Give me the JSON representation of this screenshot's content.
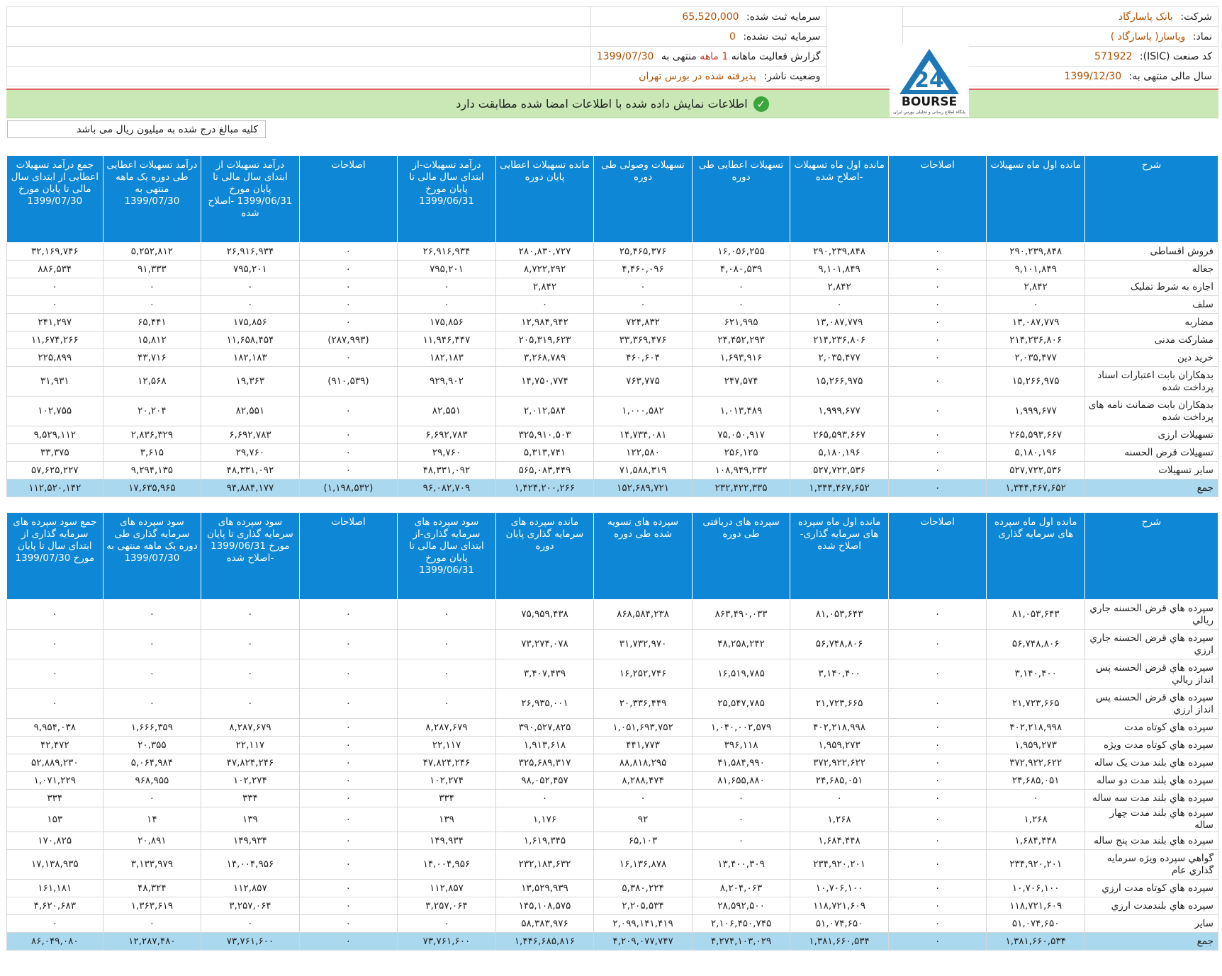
{
  "header": {
    "company_label": "شرکت:",
    "company_value": "بانک پاسارگاد",
    "symbol_label": "نماد:",
    "symbol_value": "وپاسار( پاسارگاد )",
    "isic_label": "کد صنعت (ISIC):",
    "isic_value": "571922",
    "fy_label": "سال مالی منتهی به:",
    "fy_value": "1399/12/30",
    "cap_reg_label": "سرمایه ثبت شده:",
    "cap_reg_value": "65,520,000",
    "cap_unreg_label": "سرمایه ثبت نشده:",
    "cap_unreg_value": "0",
    "report_prefix": "گزارش فعالیت ماهانه",
    "report_months": "1 ماهه",
    "report_mid": "منتهی به",
    "report_date": "1399/07/30",
    "status_label": "وضعیت ناشر:",
    "status_value": "پذیرفته شده در بورس تهران"
  },
  "logo": {
    "brand": "BOURSE",
    "tagline": "پایگاه اطلاع رسانی و تحلیلی بورس ایران"
  },
  "banner": {
    "text": "اطلاعات نمایش داده شده با اطلاعات امضا شده مطابقت دارد",
    "icon": "check-circle-icon",
    "color": "#c9e8b5"
  },
  "note": "کلیه مبالغ درج شده به میلیون ریال می باشد",
  "colors": {
    "header_bg": "#0d87d6",
    "total_bg": "#a9d8ef",
    "accent": "#b05000"
  },
  "table1": {
    "headers": [
      "شرح",
      "مانده اول ماه تسهیلات",
      "اصلاحات",
      "مانده اول ماه تسهیلات -اصلاح شده",
      "تسهیلات اعطایی طی دوره",
      "تسهیلات وصولی طی دوره",
      "مانده تسهیلات اعطایی پایان دوره",
      "درآمد تسهیلات-از ابتدای سال مالی تا پایان مورخ 1399/06/31",
      "اصلاحات",
      "درآمد تسهیلات از ابتدای سال مالی تا پایان مورخ 1399/06/31 -اصلاح شده",
      "درآمد تسهیلات اعطایی طی دوره یک ماهه منتهی به 1399/07/30",
      "جمع درآمد تسهیلات اعطایی از ابتدای سال مالی تا پایان مورخ 1399/07/30"
    ],
    "rows": [
      [
        "فروش اقساطی",
        "۲۹۰,۲۳۹,۸۴۸",
        "۰",
        "۲۹۰,۲۳۹,۸۴۸",
        "۱۶,۰۵۶,۲۵۵",
        "۲۵,۴۶۵,۳۷۶",
        "۲۸۰,۸۳۰,۷۲۷",
        "۲۶,۹۱۶,۹۳۴",
        "۰",
        "۲۶,۹۱۶,۹۳۴",
        "۵,۲۵۲,۸۱۲",
        "۳۲,۱۶۹,۷۴۶"
      ],
      [
        "جعاله",
        "۹,۱۰۱,۸۴۹",
        "۰",
        "۹,۱۰۱,۸۴۹",
        "۴,۰۸۰,۵۳۹",
        "۴,۴۶۰,۰۹۶",
        "۸,۷۲۲,۲۹۲",
        "۷۹۵,۲۰۱",
        "۰",
        "۷۹۵,۲۰۱",
        "۹۱,۳۳۳",
        "۸۸۶,۵۳۴"
      ],
      [
        "اجاره به شرط تملیک",
        "۲,۸۴۲",
        "۰",
        "۲,۸۴۲",
        "۰",
        "۰",
        "۲,۸۴۲",
        "۰",
        "۰",
        "۰",
        "۰",
        "۰"
      ],
      [
        "سلف",
        "۰",
        "۰",
        "۰",
        "۰",
        "۰",
        "۰",
        "۰",
        "۰",
        "۰",
        "۰",
        "۰"
      ],
      [
        "مضاربه",
        "۱۳,۰۸۷,۷۷۹",
        "۰",
        "۱۳,۰۸۷,۷۷۹",
        "۶۲۱,۹۹۵",
        "۷۲۴,۸۳۲",
        "۱۲,۹۸۴,۹۴۲",
        "۱۷۵,۸۵۶",
        "۰",
        "۱۷۵,۸۵۶",
        "۶۵,۴۴۱",
        "۲۴۱,۲۹۷"
      ],
      [
        "مشارکت مدنی",
        "۲۱۴,۲۳۶,۸۰۶",
        "۰",
        "۲۱۴,۲۳۶,۸۰۶",
        "۲۴,۴۵۲,۲۹۳",
        "۳۳,۳۶۹,۴۷۶",
        "۲۰۵,۳۱۹,۶۲۳",
        "۱۱,۹۴۶,۴۴۷",
        "(۲۸۷,۹۹۳)",
        "۱۱,۶۵۸,۴۵۴",
        "۱۵,۸۱۲",
        "۱۱,۶۷۴,۲۶۶"
      ],
      [
        "خرید دین",
        "۲,۰۳۵,۴۷۷",
        "۰",
        "۲,۰۳۵,۴۷۷",
        "۱,۶۹۳,۹۱۶",
        "۴۶۰,۶۰۴",
        "۳,۲۶۸,۷۸۹",
        "۱۸۲,۱۸۳",
        "۰",
        "۱۸۲,۱۸۳",
        "۴۳,۷۱۶",
        "۲۲۵,۸۹۹"
      ],
      [
        "بدهکاران بابت اعتبارات اسناد پرداخت شده",
        "۱۵,۲۶۶,۹۷۵",
        "۰",
        "۱۵,۲۶۶,۹۷۵",
        "۲۴۷,۵۷۴",
        "۷۶۳,۷۷۵",
        "۱۴,۷۵۰,۷۷۴",
        "۹۲۹,۹۰۲",
        "(۹۱۰,۵۳۹)",
        "۱۹,۳۶۳",
        "۱۲,۵۶۸",
        "۳۱,۹۳۱"
      ],
      [
        "بدهکاران بابت ضمانت نامه های پرداخت شده",
        "۱,۹۹۹,۶۷۷",
        "۰",
        "۱,۹۹۹,۶۷۷",
        "۱,۰۱۳,۴۸۹",
        "۱,۰۰۰,۵۸۲",
        "۲,۰۱۲,۵۸۴",
        "۸۲,۵۵۱",
        "۰",
        "۸۲,۵۵۱",
        "۲۰,۲۰۴",
        "۱۰۲,۷۵۵"
      ],
      [
        "تسهیلات ارزی",
        "۲۶۵,۵۹۳,۶۶۷",
        "۰",
        "۲۶۵,۵۹۳,۶۶۷",
        "۷۵,۰۵۰,۹۱۷",
        "۱۴,۷۳۴,۰۸۱",
        "۳۲۵,۹۱۰,۵۰۳",
        "۶,۶۹۲,۷۸۳",
        "۰",
        "۶,۶۹۲,۷۸۳",
        "۲,۸۳۶,۳۲۹",
        "۹,۵۲۹,۱۱۲"
      ],
      [
        "تسهیلات قرض الحسنه",
        "۵,۱۸۰,۱۹۶",
        "۰",
        "۵,۱۸۰,۱۹۶",
        "۲۵۶,۱۲۵",
        "۱۲۲,۵۸۰",
        "۵,۳۱۳,۷۴۱",
        "۲۹,۷۶۰",
        "۰",
        "۲۹,۷۶۰",
        "۳,۶۱۵",
        "۳۳,۳۷۵"
      ],
      [
        "سایر تسهیلات",
        "۵۲۷,۷۲۲,۵۳۶",
        "۰",
        "۵۲۷,۷۲۲,۵۳۶",
        "۱۰۸,۹۴۹,۲۳۲",
        "۷۱,۵۸۸,۳۱۹",
        "۵۶۵,۰۸۳,۴۴۹",
        "۴۸,۳۳۱,۰۹۲",
        "۰",
        "۴۸,۳۳۱,۰۹۲",
        "۹,۲۹۴,۱۳۵",
        "۵۷,۶۲۵,۲۲۷"
      ]
    ],
    "total": [
      "جمع",
      "۱,۳۴۴,۴۶۷,۶۵۲",
      "۰",
      "۱,۳۴۴,۴۶۷,۶۵۲",
      "۲۳۲,۴۲۲,۳۳۵",
      "۱۵۲,۶۸۹,۷۲۱",
      "۱,۴۲۴,۲۰۰,۲۶۶",
      "۹۶,۰۸۲,۷۰۹",
      "(۱,۱۹۸,۵۳۲)",
      "۹۴,۸۸۴,۱۷۷",
      "۱۷,۶۳۵,۹۶۵",
      "۱۱۲,۵۲۰,۱۴۲"
    ]
  },
  "table2": {
    "headers": [
      "شرح",
      "مانده اول ماه سپرده های سرمایه گذاری",
      "اصلاحات",
      "مانده اول ماه سپرده های سرمایه گذاری- اصلاح شده",
      "سپرده های دریافتی طی دوره",
      "سپرده های تسویه شده طی دوره",
      "مانده سپرده های سرمایه گذاری پایان دوره",
      "سود سپرده های سرمایه گذاری-از ابتدای سال مالی تا پایان مورخ 1399/06/31",
      "اصلاحات",
      "سود سپرده های سرمایه گذاری تا پایان مورخ 1399/06/31 -اصلاح شده",
      "سود سپرده های سرمایه گذاری طی دوره یک ماهه منتهی به 1399/07/30",
      "جمع سود سپرده های سرمایه گذاری از ابتدای سال تا پایان مورخ 1399/07/30"
    ],
    "rows": [
      [
        "سپرده هاي قرض الحسنه جاري ريالي",
        "۸۱,۰۵۳,۶۴۳",
        "۰",
        "۸۱,۰۵۳,۶۴۳",
        "۸۶۳,۴۹۰,۰۳۳",
        "۸۶۸,۵۸۴,۲۳۸",
        "۷۵,۹۵۹,۴۳۸",
        "۰",
        "۰",
        "۰",
        "۰",
        "۰"
      ],
      [
        "سپرده هاي قرض الحسنه جاري ارزي",
        "۵۶,۷۴۸,۸۰۶",
        "۰",
        "۵۶,۷۴۸,۸۰۶",
        "۴۸,۲۵۸,۲۴۲",
        "۳۱,۷۳۲,۹۷۰",
        "۷۳,۲۷۴,۰۷۸",
        "۰",
        "۰",
        "۰",
        "۰",
        "۰"
      ],
      [
        "سپرده هاي قرض الحسنه پس انداز ريالي",
        "۳,۱۴۰,۴۰۰",
        "۰",
        "۳,۱۴۰,۴۰۰",
        "۱۶,۵۱۹,۷۸۵",
        "۱۶,۲۵۲,۷۴۶",
        "۳,۴۰۷,۴۳۹",
        "۰",
        "۰",
        "۰",
        "۰",
        "۰"
      ],
      [
        "سپرده هاي قرض الحسنه پس انداز ارزي",
        "۲۱,۷۲۳,۶۶۵",
        "۰",
        "۲۱,۷۲۳,۶۶۵",
        "۲۵,۵۴۷,۷۸۵",
        "۲۰,۳۳۶,۴۴۹",
        "۲۶,۹۳۵,۰۰۱",
        "۰",
        "۰",
        "۰",
        "۰",
        "۰"
      ],
      [
        "سپرده هاي کوتاه مدت",
        "۴۰۲,۲۱۸,۹۹۸",
        "۰",
        "۴۰۲,۲۱۸,۹۹۸",
        "۱,۰۴۰,۰۰۲,۵۷۹",
        "۱,۰۵۱,۶۹۳,۷۵۲",
        "۳۹۰,۵۲۷,۸۲۵",
        "۸,۲۸۷,۶۷۹",
        "۰",
        "۸,۲۸۷,۶۷۹",
        "۱,۶۶۶,۳۵۹",
        "۹,۹۵۴,۰۳۸"
      ],
      [
        "سپرده هاي کوتاه مدت ويژه",
        "۱,۹۵۹,۲۷۳",
        "۰",
        "۱,۹۵۹,۲۷۳",
        "۳۹۶,۱۱۸",
        "۴۴۱,۷۷۳",
        "۱,۹۱۳,۶۱۸",
        "۲۲,۱۱۷",
        "۰",
        "۲۲,۱۱۷",
        "۲۰,۳۵۵",
        "۴۲,۴۷۲"
      ],
      [
        "سپرده هاي بلند مدت يک ساله",
        "۳۷۲,۹۲۲,۶۲۲",
        "۰",
        "۳۷۲,۹۲۲,۶۲۲",
        "۴۱,۵۸۴,۹۹۰",
        "۸۸,۸۱۸,۲۹۵",
        "۳۲۵,۶۸۹,۳۱۷",
        "۴۷,۸۲۴,۲۴۶",
        "۰",
        "۴۷,۸۲۴,۲۴۶",
        "۵,۰۶۴,۹۸۴",
        "۵۲,۸۸۹,۲۳۰"
      ],
      [
        "سپرده هاي بلند مدت دو ساله",
        "۲۴,۶۸۵,۰۵۱",
        "۰",
        "۲۴,۶۸۵,۰۵۱",
        "۸۱,۶۵۵,۸۸۰",
        "۸,۲۸۸,۴۷۴",
        "۹۸,۰۵۲,۴۵۷",
        "۱۰۲,۲۷۴",
        "۰",
        "۱۰۲,۲۷۴",
        "۹۶۸,۹۵۵",
        "۱,۰۷۱,۲۲۹"
      ],
      [
        "سپرده هاي بلند مدت سه ساله",
        "۰",
        "۰",
        "۰",
        "۰",
        "۰",
        "۰",
        "۳۳۴",
        "۰",
        "۳۳۴",
        "۰",
        "۳۳۴"
      ],
      [
        "سپرده هاي بلند مدت چهار ساله",
        "۱,۲۶۸",
        "۰",
        "۱,۲۶۸",
        "۰",
        "۹۲",
        "۱,۱۷۶",
        "۱۳۹",
        "۰",
        "۱۳۹",
        "۱۴",
        "۱۵۳"
      ],
      [
        "سپرده هاي بلند مدت پنج ساله",
        "۱,۶۸۴,۴۴۸",
        "۰",
        "۱,۶۸۴,۴۴۸",
        "۰",
        "۶۵,۱۰۳",
        "۱,۶۱۹,۳۴۵",
        "۱۴۹,۹۳۴",
        "۰",
        "۱۴۹,۹۳۴",
        "۲۰,۸۹۱",
        "۱۷۰,۸۲۵"
      ],
      [
        "گواهي سپرده ويژه سرمايه گذاري عام",
        "۲۳۴,۹۲۰,۲۰۱",
        "۰",
        "۲۳۴,۹۲۰,۲۰۱",
        "۱۳,۴۰۰,۳۰۹",
        "۱۶,۱۳۶,۸۷۸",
        "۲۳۲,۱۸۳,۶۳۲",
        "۱۴,۰۰۴,۹۵۶",
        "۰",
        "۱۴,۰۰۴,۹۵۶",
        "۳,۱۳۳,۹۷۹",
        "۱۷,۱۳۸,۹۳۵"
      ],
      [
        "سپرده هاي کوتاه مدت ارزي",
        "۱۰,۷۰۶,۱۰۰",
        "۰",
        "۱۰,۷۰۶,۱۰۰",
        "۸,۲۰۴,۰۶۳",
        "۵,۳۸۰,۲۲۴",
        "۱۳,۵۲۹,۹۳۹",
        "۱۱۲,۸۵۷",
        "۰",
        "۱۱۲,۸۵۷",
        "۴۸,۳۲۴",
        "۱۶۱,۱۸۱"
      ],
      [
        "سپرده هاي بلندمدت ارزي",
        "۱۱۸,۷۲۱,۶۰۹",
        "۰",
        "۱۱۸,۷۲۱,۶۰۹",
        "۲۸,۵۹۲,۵۰۰",
        "۲,۲۰۵,۵۳۴",
        "۱۴۵,۱۰۸,۵۷۵",
        "۳,۲۵۷,۰۶۴",
        "۰",
        "۳,۲۵۷,۰۶۴",
        "۱,۳۶۳,۶۱۹",
        "۴,۶۲۰,۶۸۳"
      ],
      [
        "ساير",
        "۵۱,۰۷۴,۶۵۰",
        "۰",
        "۵۱,۰۷۴,۶۵۰",
        "۲,۱۰۶,۴۵۰,۷۴۵",
        "۲,۰۹۹,۱۴۱,۴۱۹",
        "۵۸,۳۸۳,۹۷۶",
        "۰",
        "۰",
        "۰",
        "۰",
        "۰"
      ]
    ],
    "total": [
      "جمع",
      "۱,۳۸۱,۶۶۰,۵۳۴",
      "۰",
      "۱,۳۸۱,۶۶۰,۵۳۴",
      "۴,۲۷۴,۱۰۳,۰۲۹",
      "۴,۲۰۹,۰۷۷,۷۴۷",
      "۱,۴۴۶,۶۸۵,۸۱۶",
      "۷۳,۷۶۱,۶۰۰",
      "۰",
      "۷۳,۷۶۱,۶۰۰",
      "۱۲,۲۸۷,۴۸۰",
      "۸۶,۰۴۹,۰۸۰"
    ]
  }
}
